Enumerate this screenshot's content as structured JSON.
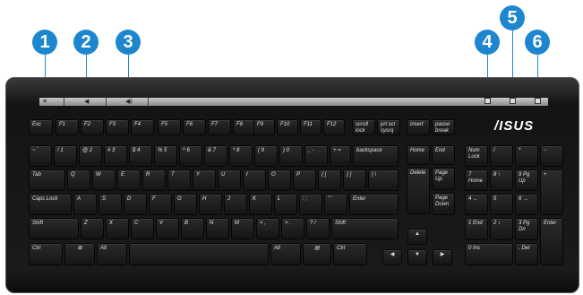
{
  "callouts": [
    "1",
    "2",
    "3",
    "4",
    "5",
    "6"
  ],
  "strip_icons": {
    "brightness": "☀",
    "vol_down": "◀",
    "vol_up": "◀)"
  },
  "brand": "/ISUS",
  "function_row": [
    "Esc",
    "F1",
    "F2",
    "F3",
    "F4",
    "F5",
    "F6",
    "F7",
    "F8",
    "F9",
    "F10",
    "F11",
    "F12",
    "scroll lock",
    "prt scr sysrq",
    "insert",
    "pause break"
  ],
  "number_row": [
    "~ `",
    "! 1",
    "@ 2",
    "# 3",
    "$ 4",
    "% 5",
    "^ 6",
    "& 7",
    "* 8",
    "( 9",
    ") 0",
    "_ -",
    "+ =",
    "backspace"
  ],
  "qwerty_row": [
    "Tab",
    "Q",
    "W",
    "E",
    "R",
    "T",
    "Y",
    "U",
    "I",
    "O",
    "P",
    "{ [",
    "} ]",
    "| \\"
  ],
  "home_row": [
    "Caps Lock",
    "A",
    "S",
    "D",
    "F",
    "G",
    "H",
    "J",
    "K",
    "L",
    ": ;",
    "\" '",
    "Enter"
  ],
  "shift_row": [
    "Shift",
    "Z",
    "X",
    "C",
    "V",
    "B",
    "N",
    "M",
    "< ,",
    "> .",
    "? /",
    "Shift"
  ],
  "bottom_row": [
    "Ctrl",
    "⊞",
    "Alt",
    "",
    "Alt",
    "▤",
    "Ctrl"
  ],
  "nav_keys": [
    "Home",
    "End",
    "Delete",
    "Page Up",
    "Page Down"
  ],
  "arrows": [
    "▲",
    "◀",
    "▼",
    "▶"
  ],
  "numpad": [
    "Num Lock",
    "/",
    "*",
    "−",
    "7 Home",
    "8 ↑",
    "9 Pg Up",
    "+",
    "4 ←",
    "5",
    "6 →",
    "1 End",
    "2 ↓",
    "3 Pg Dn",
    "Enter",
    "0 Ins",
    ". Del"
  ]
}
